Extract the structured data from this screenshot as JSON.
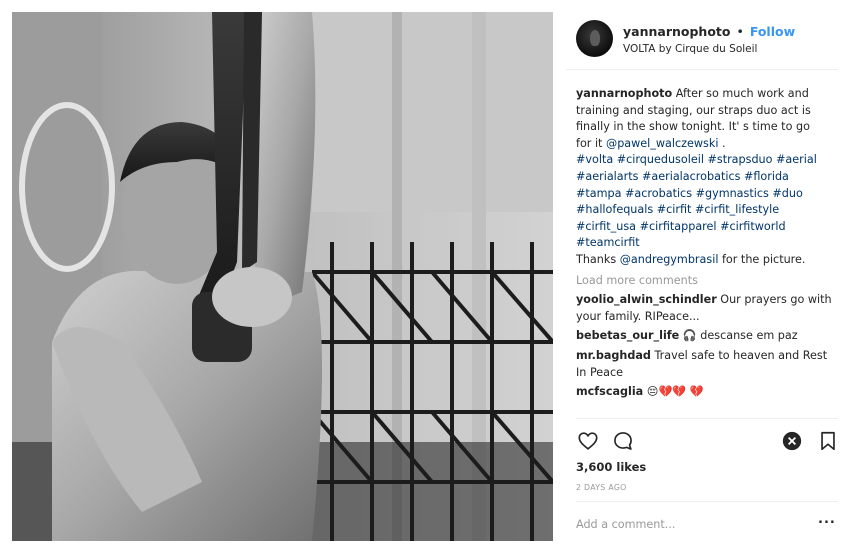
{
  "post": {
    "username": "yannarnophoto",
    "separator": "•",
    "follow_label": "Follow",
    "location": "VOLTA by Cirque du Soleil",
    "photo_alt": "Black and white photo of an aerial straps performer"
  },
  "caption": {
    "username": "yannarnophoto",
    "line1": " After so much work and",
    "line2": "training and staging, our straps duo act is",
    "line3": "finally in the show tonight. It' s time to go",
    "line4_prefix": "for it ",
    "mention1": "@pawel_walczewski",
    "line4_suffix": " .",
    "hashtags": [
      "#volta #cirquedusoleil #strapsduo #aerial",
      "#aerialarts #aerialacrobatics #florida",
      "#tampa #acrobatics #gymnastics #duo",
      "#hallofequals #cirfit #cirfit_lifestyle",
      "#cirfit_usa #cirfitapparel #cirfitworld",
      "#teamcirfit"
    ],
    "thanks_prefix": "Thanks ",
    "mention2": "@andregymbrasil",
    "thanks_suffix": " for the picture."
  },
  "load_more_label": "Load more comments",
  "comments": [
    {
      "user": "yoolio_alwin_schindler",
      "text": " Our prayers go with",
      "text2": "your family. RIPeace..."
    },
    {
      "user": "bebetas_our_life",
      "text": " 🎧 descanse em paz"
    },
    {
      "user": "mr.baghdad",
      "text": " Travel safe to heaven and Rest",
      "text2": "In Peace"
    },
    {
      "user": "mcfscaglia",
      "text": " 😔💔💔 💔"
    }
  ],
  "actions": {
    "like_icon": "heart-outline-icon",
    "comment_icon": "comment-bubble-icon",
    "close_icon": "close-circle-icon",
    "save_icon": "bookmark-icon"
  },
  "likes_label": "3,600 likes",
  "timestamp": "2 DAYS AGO",
  "add_comment_placeholder": "Add a comment...",
  "more_options_label": "...",
  "colors": {
    "link_blue": "#3897f0",
    "hashtag_blue": "#003569",
    "muted_gray": "#999999",
    "text_dark": "#262626",
    "divider": "#efefef"
  }
}
